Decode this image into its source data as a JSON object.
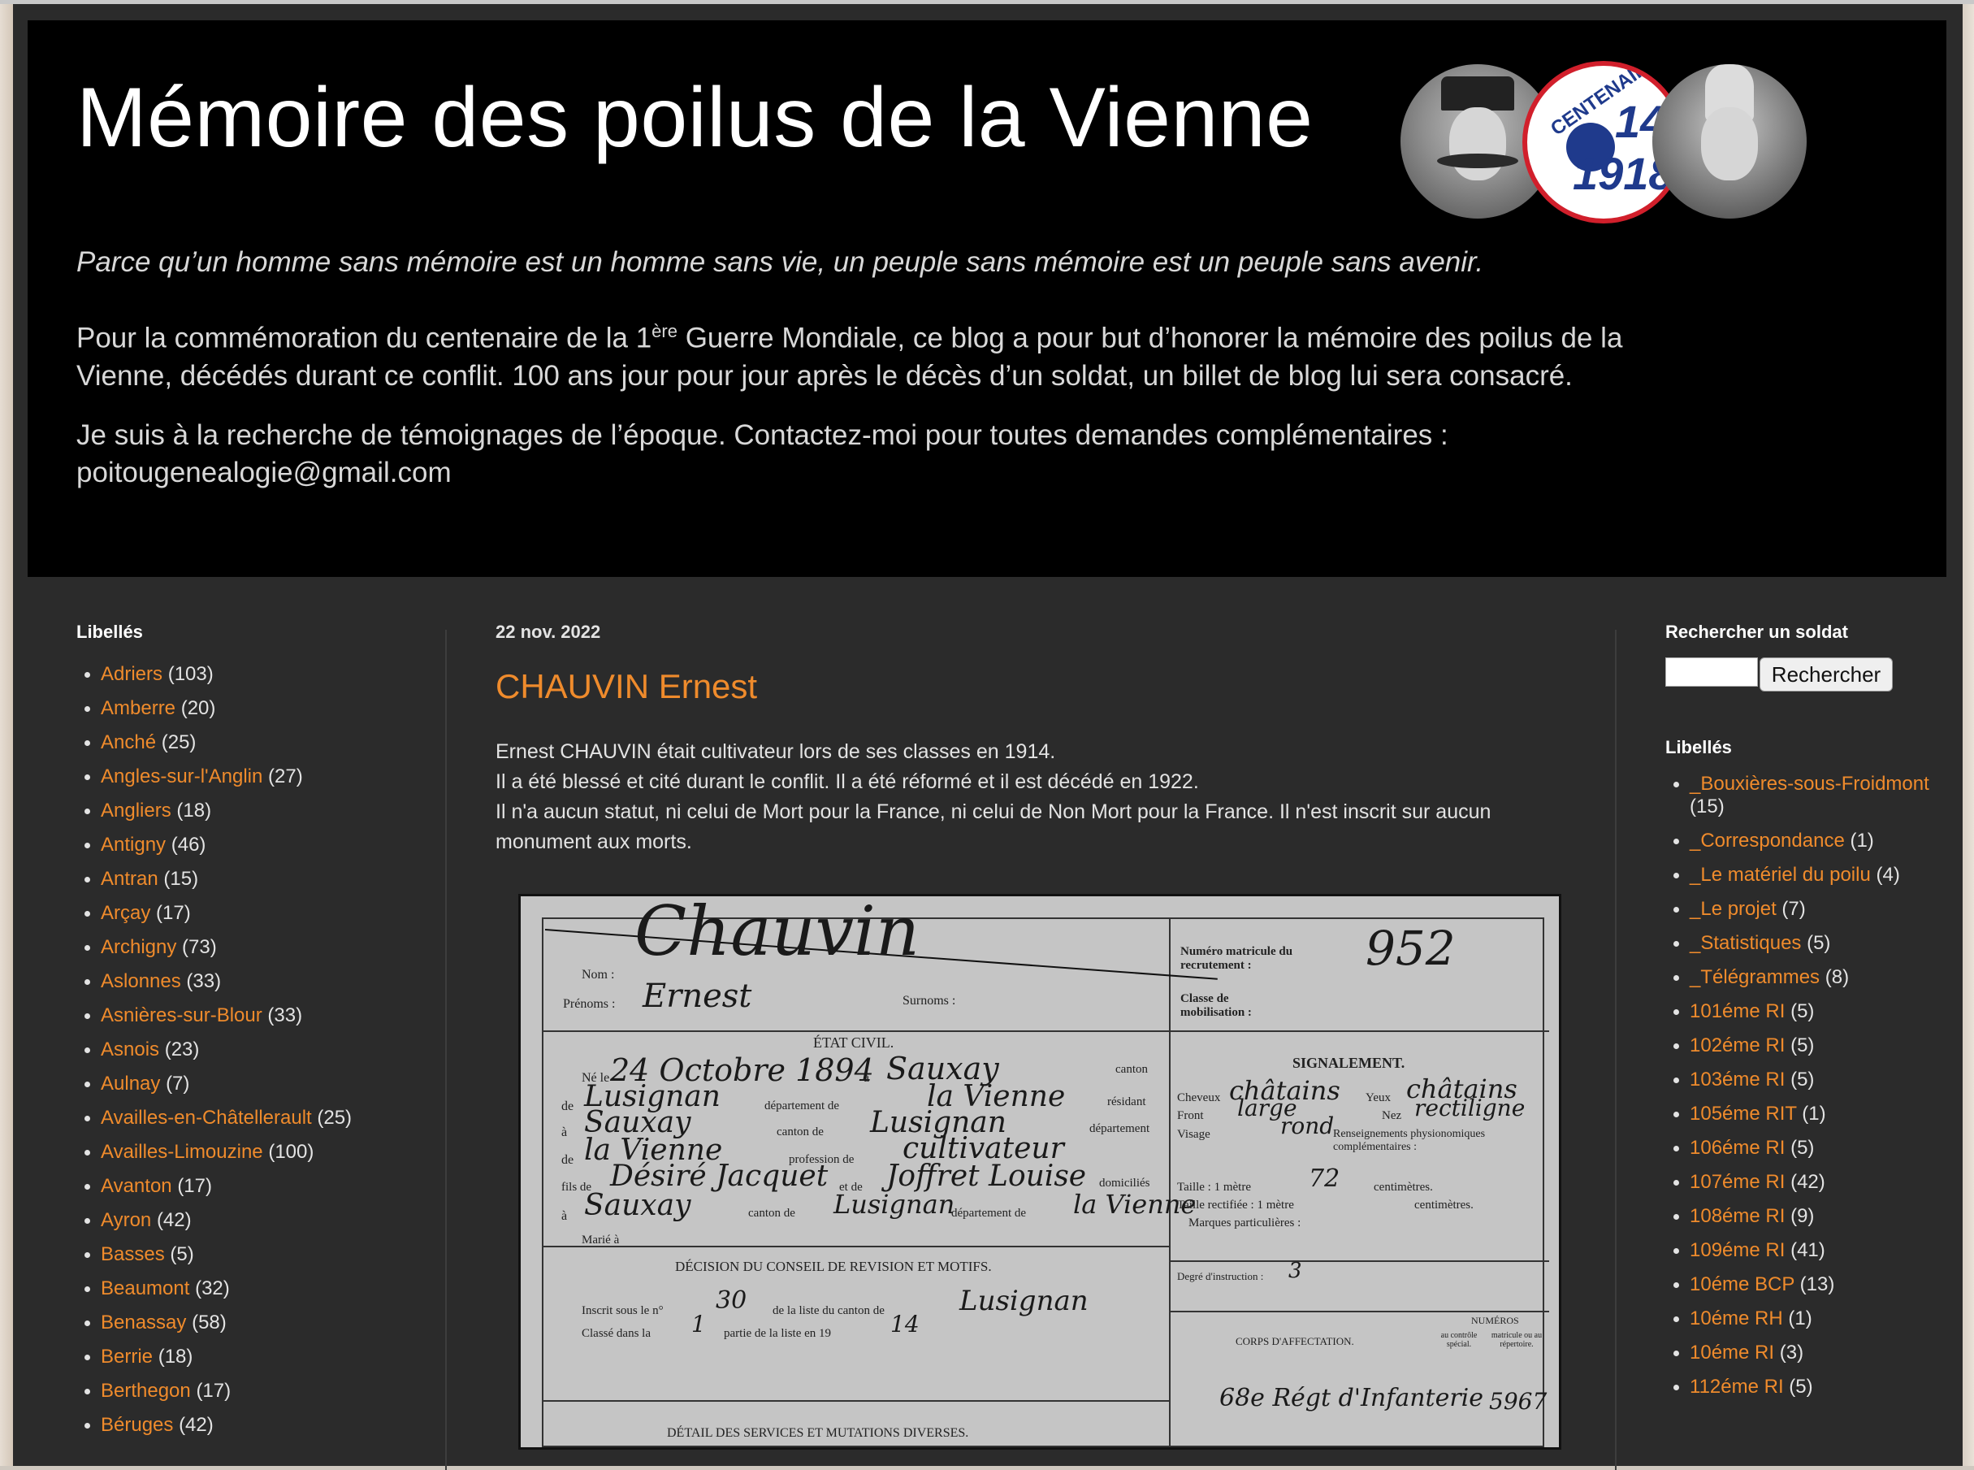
{
  "header": {
    "title": "Mémoire des poilus de la Vienne",
    "motto": "Parce qu’un homme sans mémoire est un homme sans vie, un peuple sans mémoire est un peuple sans avenir.",
    "intro_part1": "Pour la commémoration du centenaire de la 1",
    "intro_sup": "ère",
    "intro_part2": " Guerre Mondiale, ce blog a pour but d’honorer la mémoire des poilus de la Vienne, décédés durant ce conflit. 100 ans jour pour jour après le décès d’un soldat, un billet de blog lui sera consacré.",
    "contact_line1": "Je suis à la recherche de témoignages de l’époque. Contactez-moi pour toutes demandes complémentaires :",
    "contact_line2": "poitougenealogie@gmail.com",
    "logo_arc": "CENTENAIRE",
    "logo_year_a": "14",
    "logo_year_b": "1918"
  },
  "left_sidebar": {
    "title": "Libellés",
    "items": [
      {
        "name": "Adriers",
        "count": "(103)"
      },
      {
        "name": "Amberre",
        "count": "(20)"
      },
      {
        "name": "Anché",
        "count": "(25)"
      },
      {
        "name": "Angles-sur-l'Anglin",
        "count": "(27)"
      },
      {
        "name": "Angliers",
        "count": "(18)"
      },
      {
        "name": "Antigny",
        "count": "(46)"
      },
      {
        "name": "Antran",
        "count": "(15)"
      },
      {
        "name": "Arçay",
        "count": "(17)"
      },
      {
        "name": "Archigny",
        "count": "(73)"
      },
      {
        "name": "Aslonnes",
        "count": "(33)"
      },
      {
        "name": "Asnières-sur-Blour",
        "count": "(33)"
      },
      {
        "name": "Asnois",
        "count": "(23)"
      },
      {
        "name": "Aulnay",
        "count": "(7)"
      },
      {
        "name": "Availles-en-Châtellerault",
        "count": "(25)"
      },
      {
        "name": "Availles-Limouzine",
        "count": "(100)"
      },
      {
        "name": "Avanton",
        "count": "(17)"
      },
      {
        "name": "Ayron",
        "count": "(42)"
      },
      {
        "name": "Basses",
        "count": "(5)"
      },
      {
        "name": "Beaumont",
        "count": "(32)"
      },
      {
        "name": "Benassay",
        "count": "(58)"
      },
      {
        "name": "Berrie",
        "count": "(18)"
      },
      {
        "name": "Berthegon",
        "count": "(17)"
      },
      {
        "name": "Béruges",
        "count": "(42)"
      }
    ]
  },
  "post": {
    "date": "22 nov. 2022",
    "title": "CHAUVIN Ernest",
    "paragraphs": [
      "Ernest CHAUVIN était cultivateur lors de ses classes en 1914.",
      "Il a été blessé et cité durant le conflit. Il a été réformé et il est décédé en 1922.",
      "Il n'a aucun statut, ni celui de Mort pour la France, ni celui de Non Mort pour la France. Il n'est inscrit sur aucun monument aux morts."
    ]
  },
  "document": {
    "name_hw": "Chauvin",
    "label_nom": "Nom :",
    "label_prenoms": "Prénoms :",
    "prenom_hw": "Ernest",
    "label_surnoms": "Surnoms :",
    "label_matricule": "Numéro matricule du recrutement :",
    "matricule_hw": "952",
    "label_classe": "Classe de mobilisation :",
    "section_etat_civil": "ÉTAT CIVIL.",
    "label_ne_le": "Né le",
    "date_hw": "24 Octobre 1894",
    "label_a": "à",
    "lieu_hw": "Sauxay",
    "label_canton": "canton",
    "label_de": "de",
    "canton_hw": "Lusignan",
    "label_departement_de": "département de",
    "dept_hw": "la Vienne",
    "label_residant": "résidant",
    "label_canton_de": "canton de",
    "label_departement": "département",
    "label_profession": "profession de",
    "profession_hw": "cultivateur",
    "label_fils_de": "fils de",
    "pere_hw": "Désiré Jacquet",
    "label_et_de": "et de",
    "mere_hw": "Joffret Louise",
    "label_domicilies": "domiciliés",
    "label_marie": "Marié à",
    "section_signalement": "SIGNALEMENT.",
    "label_cheveux": "Cheveux",
    "cheveux_hw": "châtains",
    "label_yeux": "Yeux",
    "yeux_hw": "châtains",
    "label_front": "Front",
    "front_hw": "large",
    "label_nez": "Nez",
    "nez_hw": "rectiligne",
    "label_visage": "Visage",
    "visage_hw": "rond",
    "label_renseignements": "Renseignements physionomiques complémentaires :",
    "label_taille": "Taille : 1 mètre",
    "taille_hw": "72",
    "label_centimetres": "centimètres.",
    "label_taille_rectifiee": "Taille rectifiée : 1 mètre",
    "label_marques": "Marques particulières :",
    "section_decision": "DÉCISION DU CONSEIL DE REVISION ET MOTIFS.",
    "label_inscrit": "Inscrit sous le n°",
    "inscrit_hw": "30",
    "label_liste_canton": "de la liste du canton de",
    "label_classe_dans": "Classé dans la",
    "classe_hw": "1",
    "label_partie": "partie de la liste en 19",
    "annee_hw": "14",
    "label_degre": "Degré d'instruction :",
    "degre_hw": "3",
    "label_numeros": "NUMÉROS",
    "label_corps": "CORPS D'AFFECTATION.",
    "label_au_controle": "au contrôle spécial.",
    "label_matricule_rep": "matricule ou au répertoire.",
    "regiment_hw": "68e Régt d'Infanterie",
    "num_hw": "5967",
    "section_detail": "DÉTAIL DES SERVICES ET MUTATIONS DIVERSES."
  },
  "right_sidebar": {
    "search_title": "Rechercher un soldat",
    "search_value": "",
    "search_button": "Rechercher",
    "labels_title": "Libellés",
    "items": [
      {
        "name": "_Bouxières-sous-Froidmont",
        "count": "(15)"
      },
      {
        "name": "_Correspondance",
        "count": "(1)"
      },
      {
        "name": "_Le matériel du poilu",
        "count": "(4)"
      },
      {
        "name": "_Le projet",
        "count": "(7)"
      },
      {
        "name": "_Statistiques",
        "count": "(5)"
      },
      {
        "name": "_Télégrammes",
        "count": "(8)"
      },
      {
        "name": "101éme RI",
        "count": "(5)"
      },
      {
        "name": "102éme RI",
        "count": "(5)"
      },
      {
        "name": "103éme RI",
        "count": "(5)"
      },
      {
        "name": "105éme RIT",
        "count": "(1)"
      },
      {
        "name": "106éme RI",
        "count": "(5)"
      },
      {
        "name": "107éme RI",
        "count": "(42)"
      },
      {
        "name": "108éme RI",
        "count": "(9)"
      },
      {
        "name": "109éme RI",
        "count": "(41)"
      },
      {
        "name": "10éme BCP",
        "count": "(13)"
      },
      {
        "name": "10éme RH",
        "count": "(1)"
      },
      {
        "name": "10éme RI",
        "count": "(3)"
      },
      {
        "name": "112éme RI",
        "count": "(5)"
      }
    ]
  }
}
